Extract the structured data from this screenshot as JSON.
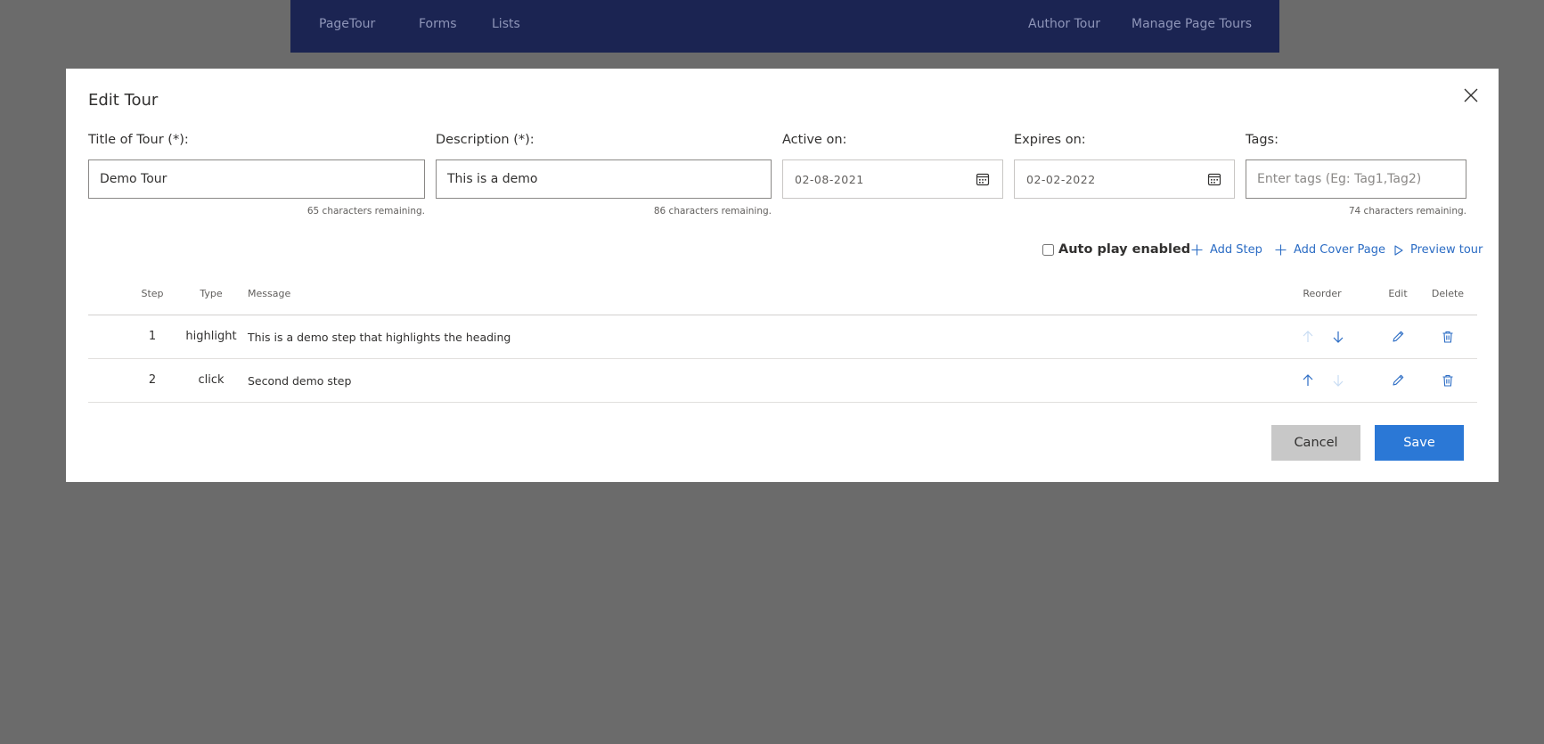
{
  "nav": {
    "left_items": [
      "PageTour",
      "Forms",
      "Lists"
    ],
    "right_items": [
      "Author Tour",
      "Manage Page Tours"
    ]
  },
  "modal": {
    "title": "Edit Tour",
    "close_icon": "close-icon"
  },
  "form": {
    "title_label": "Title of Tour (*):",
    "title_value": "Demo Tour",
    "title_remaining": "65 characters remaining.",
    "description_label": "Description (*):",
    "description_value": "This is a demo",
    "description_remaining": "86 characters remaining.",
    "active_label": "Active on:",
    "active_value": "02-08-2021",
    "expires_label": "Expires on:",
    "expires_value": "02-02-2022",
    "tags_label": "Tags:",
    "tags_placeholder": "Enter tags (Eg: Tag1,Tag2)",
    "tags_remaining": "74 characters remaining."
  },
  "actions": {
    "autoplay_label": "Auto play enabled",
    "autoplay_checked": false,
    "add_step": "Add Step",
    "add_cover_page": "Add Cover Page",
    "preview_tour": "Preview tour"
  },
  "table": {
    "headers": {
      "step": "Step",
      "type": "Type",
      "message": "Message",
      "reorder": "Reorder",
      "edit": "Edit",
      "delete": "Delete"
    },
    "rows": [
      {
        "step": "1",
        "type": "highlight",
        "message": "This is a demo step that highlights the heading",
        "can_move_up": false,
        "can_move_down": true
      },
      {
        "step": "2",
        "type": "click",
        "message": "Second demo step",
        "can_move_up": true,
        "can_move_down": false
      }
    ]
  },
  "footer": {
    "cancel_label": "Cancel",
    "save_label": "Save"
  },
  "colors": {
    "nav_bg": "#1b2452",
    "overlay": "#6b6b6b",
    "accent": "#2b78d6",
    "link": "#2b6cc4"
  }
}
